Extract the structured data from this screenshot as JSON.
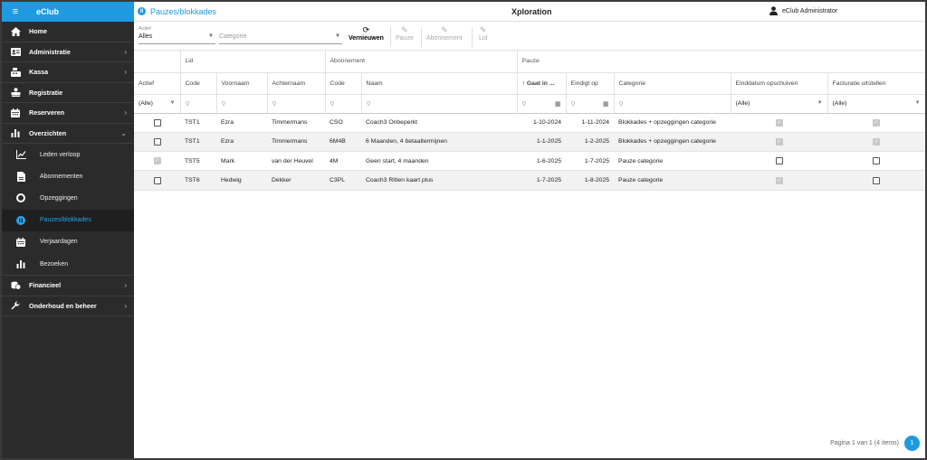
{
  "app": {
    "brand": "eClub",
    "title": "Xploration",
    "breadcrumb": "Pauzes/blokkades",
    "user": "eClub Administrator"
  },
  "sidebar": {
    "items": [
      {
        "label": "Home",
        "icon": "home-icon",
        "chevron": false
      },
      {
        "label": "Administratie",
        "icon": "id-card-icon",
        "chevron": true
      },
      {
        "label": "Kassa",
        "icon": "cash-register-icon",
        "chevron": true
      },
      {
        "label": "Registratie",
        "icon": "user-desk-icon",
        "chevron": false
      },
      {
        "label": "Reserveren",
        "icon": "calendar-icon",
        "chevron": true
      },
      {
        "label": "Overzichten",
        "icon": "bar-chart-icon",
        "chevron": true,
        "expanded": true
      }
    ],
    "subitems": [
      {
        "label": "Leden verloop",
        "icon": "line-chart-icon"
      },
      {
        "label": "Abonnementen",
        "icon": "document-icon"
      },
      {
        "label": "Opzeggingen",
        "icon": "circle-icon"
      },
      {
        "label": "Pauzes/blokkades",
        "icon": "pause-icon",
        "active": true
      },
      {
        "label": "Verjaardagen",
        "icon": "calendar-icon"
      },
      {
        "label": "Bezoeken",
        "icon": "bar-chart-icon"
      }
    ],
    "bottom": [
      {
        "label": "Financieel",
        "icon": "coins-icon",
        "chevron": true
      },
      {
        "label": "Onderhoud en beheer",
        "icon": "wrench-icon",
        "chevron": true
      }
    ]
  },
  "toolbar": {
    "actief_label": "Actief",
    "actief_value": "Alles",
    "categorie_placeholder": "Categorie",
    "refresh": "Vernieuwen",
    "pause": "Pauze",
    "abonnement": "Abonnement",
    "lid": "Lid"
  },
  "grid": {
    "groups": {
      "lid": "Lid",
      "abonnement": "Abonnement",
      "pauze": "Pauze"
    },
    "columns": {
      "actief": "Actief",
      "code": "Code",
      "voornaam": "Voornaam",
      "achternaam": "Achternaam",
      "abo_code": "Code",
      "naam": "Naam",
      "gaat_in": "Gaat in ...",
      "eindigt_op": "Eindigt op",
      "categorie": "Categorie",
      "einddatum": "Einddatum opschuiven",
      "facturatie": "Facturatie uitstellen"
    },
    "filters": {
      "actief": "(Alle)",
      "einddatum": "(Alle)",
      "facturatie": "(Alle)"
    },
    "rows": [
      {
        "actief": false,
        "code": "TST1",
        "voornaam": "Ezra",
        "achternaam": "Timmermans",
        "abo_code": "CSO",
        "naam": "Coach3 Onbeperkt",
        "gaat_in": "1-10-2024",
        "eindigt_op": "1-11-2024",
        "categorie": "Blokkades + opzeggingen categorie",
        "einddatum": true,
        "facturatie": true
      },
      {
        "actief": false,
        "code": "TST1",
        "voornaam": "Ezra",
        "achternaam": "Timmermans",
        "abo_code": "6M4B",
        "naam": "6 Maanden, 4 betaaltermijnen",
        "gaat_in": "1-1-2025",
        "eindigt_op": "1-2-2025",
        "categorie": "Blokkades + opzeggingen categorie",
        "einddatum": true,
        "facturatie": true
      },
      {
        "actief": true,
        "code": "TST5",
        "voornaam": "Mark",
        "achternaam": "van der Heuvel",
        "abo_code": "4M",
        "naam": "Geen start, 4 maanden",
        "gaat_in": "1-6-2025",
        "eindigt_op": "1-7-2025",
        "categorie": "Pauze categorie",
        "einddatum": false,
        "facturatie": false
      },
      {
        "actief": false,
        "code": "TST6",
        "voornaam": "Hedwig",
        "achternaam": "Dekker",
        "abo_code": "C3PL",
        "naam": "Coach3 Ritten kaart plus",
        "gaat_in": "1-7-2025",
        "eindigt_op": "1-8-2025",
        "categorie": "Pauze categorie",
        "einddatum": true,
        "facturatie": false
      }
    ]
  },
  "pager": {
    "text": "Pagina 1 van 1 (4 items)",
    "page": "1"
  },
  "colors": {
    "accent": "#1e9be0",
    "sidebar": "#2b2b2b"
  }
}
